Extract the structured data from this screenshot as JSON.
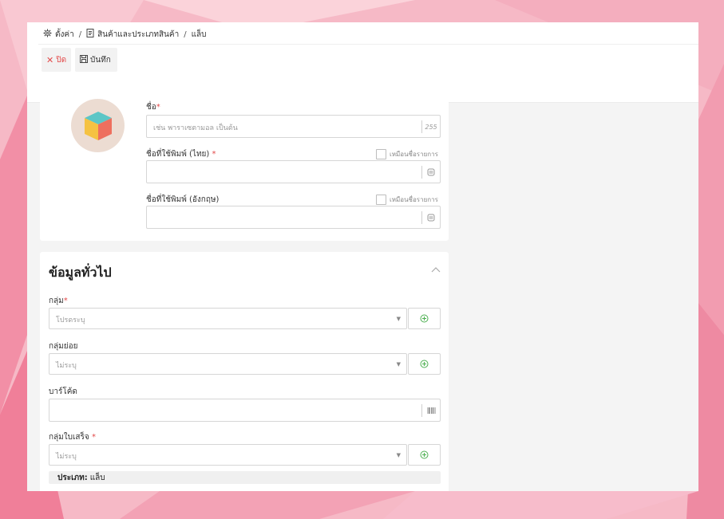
{
  "breadcrumb": {
    "settings": "ตั้งค่า",
    "products": "สินค้าและประเภทสินค้า",
    "current": "แล็บ",
    "separator": "/"
  },
  "toolbar": {
    "close_label": "ปิด",
    "save_label": "บันทึก"
  },
  "form": {
    "name_label": "ชื่อ",
    "name_required": "*",
    "name_placeholder": "เช่น พาราเซตามอล เป็นต้น",
    "name_maxlen": "255",
    "print_th_label": "ชื่อที่ใช้พิมพ์ (ไทย)",
    "print_th_required": "*",
    "print_en_label": "ชื่อที่ใช้พิมพ์ (อังกฤษ)",
    "same_as_name_label": "เหมือนชื่อรายการ"
  },
  "general": {
    "title": "ข้อมูลทั่วไป",
    "group_label": "กลุ่ม",
    "group_required": "*",
    "group_value": "โปรดระบุ",
    "subgroup_label": "กลุ่มย่อย",
    "subgroup_value": "ไม่ระบุ",
    "barcode_label": "บาร์โค้ด",
    "receipt_group_label": "กลุ่มใบเสร็จ",
    "receipt_group_required": "*",
    "receipt_group_value": "ไม่ระบุ",
    "type_label": "ประเภท:",
    "type_value": "แล็บ"
  },
  "colors": {
    "accent_green": "#4caf50",
    "danger_red": "#e34a4a",
    "background_pink": "#f6b9c6"
  },
  "icons": [
    "gear-icon",
    "document-icon",
    "close-icon",
    "save-icon",
    "cube-icon",
    "list-icon",
    "chevron-up-icon",
    "caret-down-icon",
    "plus-circle-icon",
    "barcode-icon"
  ]
}
